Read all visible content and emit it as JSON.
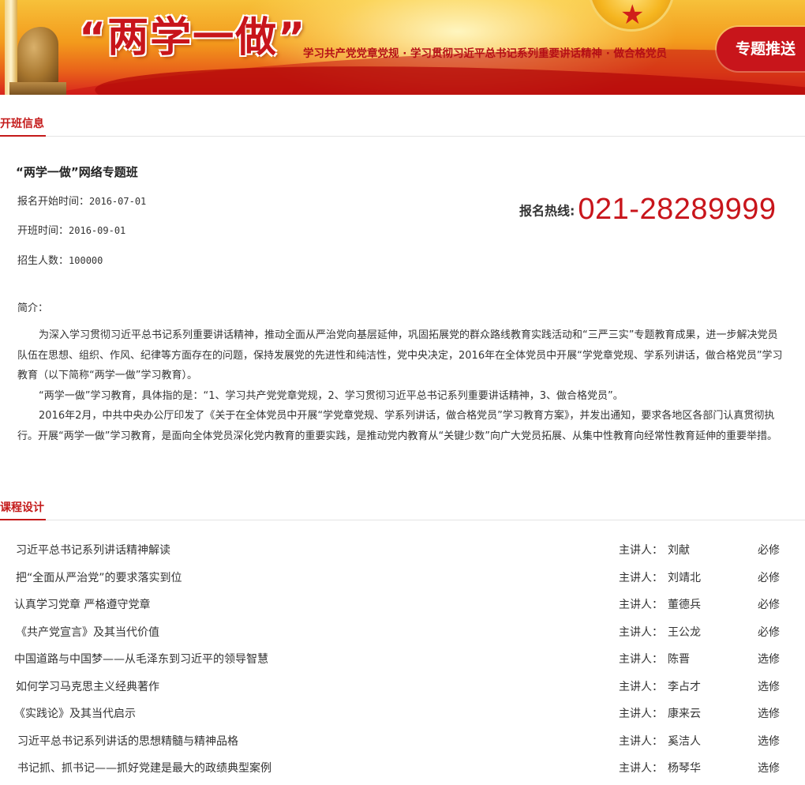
{
  "banner": {
    "title": "“两学一做”",
    "slogan": "学习共产党党章党规 · 学习贯彻习近平总书记系列重要讲话精神 · 做合格党员",
    "push_button": "专题推送"
  },
  "section_class": {
    "title": "开班信息"
  },
  "class_info": {
    "name": "“两学一做”网络专题班",
    "signup_start_label": "报名开始时间：",
    "signup_start": "2016-07-01",
    "start_label": "开班时间：",
    "start": "2016-09-01",
    "quota_label": "招生人数：",
    "quota": "100000",
    "hotline_label": "报名热线:",
    "hotline": "021-28289999",
    "intro_label": "简介：",
    "intro": [
      "为深入学习贯彻习近平总书记系列重要讲话精神，推动全面从严治党向基层延伸，巩固拓展党的群众路线教育实践活动和“三严三实”专题教育成果，进一步解决党员队伍在思想、组织、作风、纪律等方面存在的问题，保持发展党的先进性和纯洁性，党中央决定，2016年在全体党员中开展“学党章党规、学系列讲话，做合格党员”学习教育（以下简称“两学一做”学习教育）。",
      "“两学一做”学习教育，具体指的是：“1、学习共产党党章党规，2、学习贯彻习近平总书记系列重要讲话精神，3、做合格党员”。",
      "2016年2月，中共中央办公厅印发了《关于在全体党员中开展“学党章党规、学系列讲话，做合格党员”学习教育方案》，并发出通知，要求各地区各部门认真贯彻执行。开展“两学一做”学习教育，是面向全体党员深化党内教育的重要实践，是推动党内教育从“关键少数”向广大党员拓展、从集中性教育向经常性教育延伸的重要举措。"
    ]
  },
  "section_course": {
    "title": "课程设计"
  },
  "lecturer_label": "主讲人：",
  "courses": [
    {
      "title": "习近平总书记系列讲话精神解读",
      "lecturer": "刘献",
      "type": "必修"
    },
    {
      "title": "把“全面从严治党”的要求落实到位",
      "lecturer": "刘靖北",
      "type": "必修"
    },
    {
      "title": "认真学习党章 严格遵守党章",
      "lecturer": "董德兵",
      "type": "必修"
    },
    {
      "title": "《共产党宣言》及其当代价值",
      "lecturer": "王公龙",
      "type": "必修"
    },
    {
      "title": "中国道路与中国梦——从毛泽东到习近平的领导智慧",
      "lecturer": "陈晋",
      "type": "选修"
    },
    {
      "title": "如何学习马克思主义经典著作",
      "lecturer": "李占才",
      "type": "选修"
    },
    {
      "title": "《实践论》及其当代启示",
      "lecturer": "康来云",
      "type": "选修"
    },
    {
      "title": "习近平总书记系列讲话的思想精髓与精神品格",
      "lecturer": "奚洁人",
      "type": "选修"
    },
    {
      "title": "书记抓、抓书记——抓好党建是最大的政绩典型案例",
      "lecturer": "杨琴华",
      "type": "选修"
    }
  ],
  "colors": {
    "accent": "#c8151b",
    "divider": "#e4e4e4",
    "text": "#333333"
  }
}
